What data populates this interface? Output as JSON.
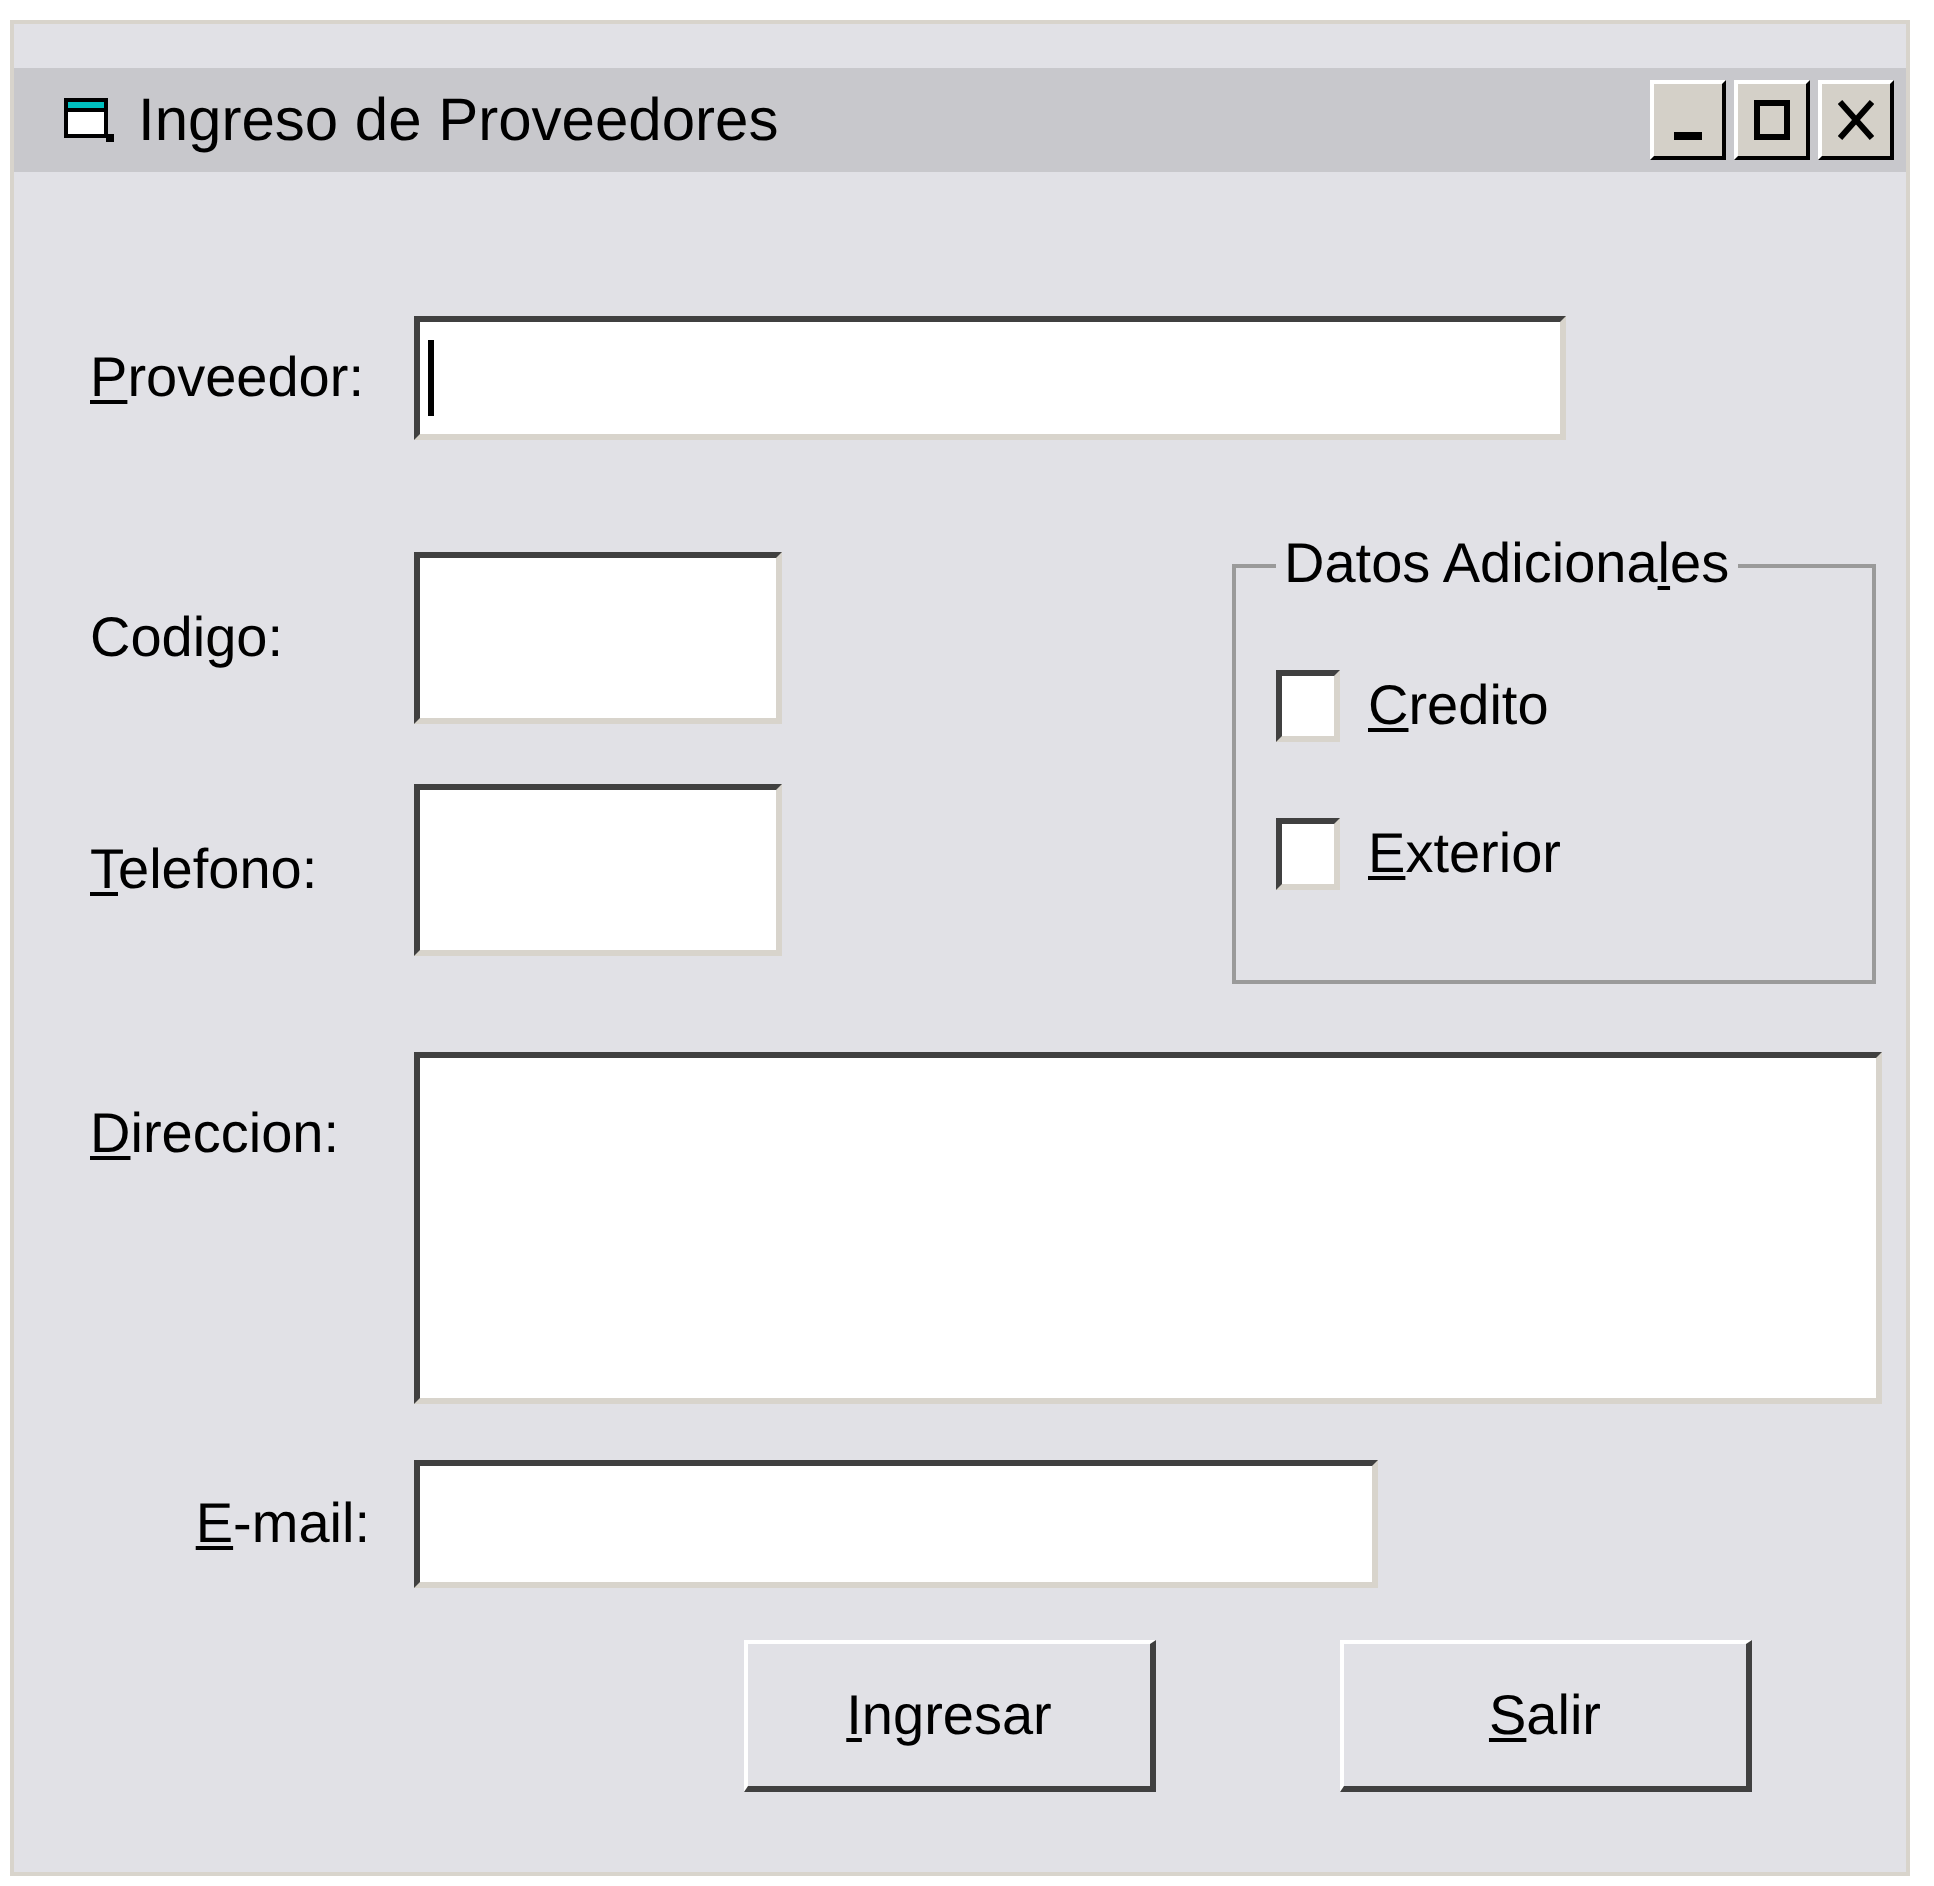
{
  "window": {
    "title": "Ingreso de Proveedores"
  },
  "proveedor": {
    "label": {
      "key": "P",
      "after": "roveedor:"
    },
    "focused": true
  },
  "codigo": {
    "label": {
      "before": "Codigo:"
    }
  },
  "telefono": {
    "label": {
      "key": "T",
      "after": "elefono:"
    }
  },
  "group": {
    "title": {
      "before": "Datos Adiciona",
      "key": "l",
      "after": "es"
    },
    "options": [
      {
        "label": {
          "key": "C",
          "after": "redito"
        },
        "checked": false
      },
      {
        "label": {
          "key": "E",
          "after": "xterior"
        },
        "checked": false
      }
    ]
  },
  "direccion": {
    "label": {
      "key": "D",
      "after": "ireccion:"
    }
  },
  "email": {
    "label": {
      "key": "E",
      "after": "-mail:"
    }
  },
  "buttons": [
    {
      "label": {
        "key": "I",
        "after": "ngresar"
      }
    },
    {
      "label": {
        "key": "S",
        "after": "alir"
      }
    }
  ]
}
